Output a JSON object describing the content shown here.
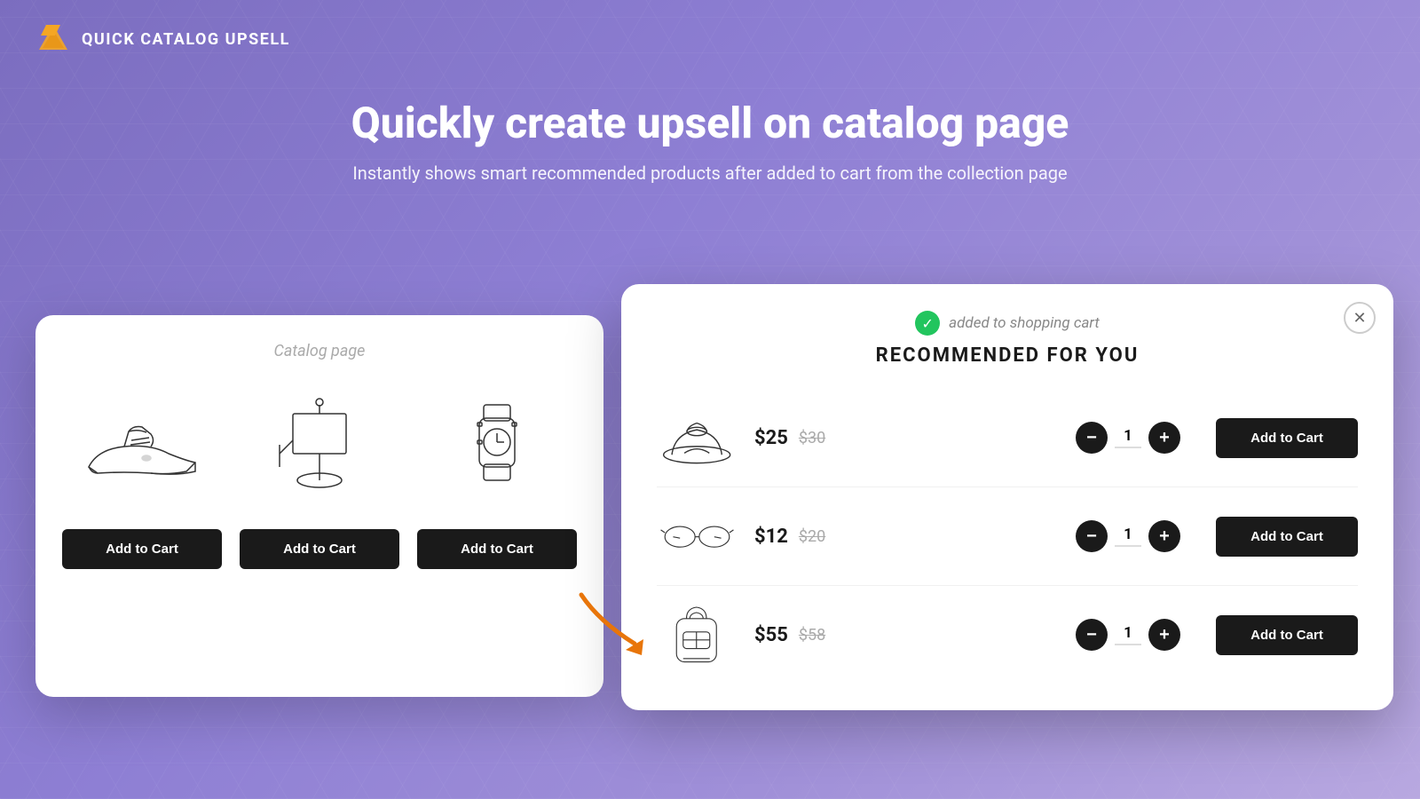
{
  "brand": {
    "name": "QUICK CATALOG UPSELL"
  },
  "hero": {
    "title": "Quickly create upsell on catalog page",
    "subtitle": "Instantly shows smart recommended products after added to cart from the collection page"
  },
  "catalog": {
    "label": "Catalog page",
    "buttons": [
      "Add to Cart",
      "Add to Cart",
      "Add to Cart"
    ]
  },
  "modal": {
    "added_text": "added to shopping cart",
    "title": "RECOMMENDED FOR YOU",
    "close_label": "✕",
    "products": [
      {
        "price": "$25",
        "original_price": "$30",
        "qty": "1",
        "btn_label": "Add to Cart",
        "image": "hat"
      },
      {
        "price": "$12",
        "original_price": "$20",
        "qty": "1",
        "btn_label": "Add to Cart",
        "image": "glasses"
      },
      {
        "price": "$55",
        "original_price": "$58",
        "qty": "1",
        "btn_label": "Add to Cart",
        "image": "backpack"
      }
    ]
  }
}
